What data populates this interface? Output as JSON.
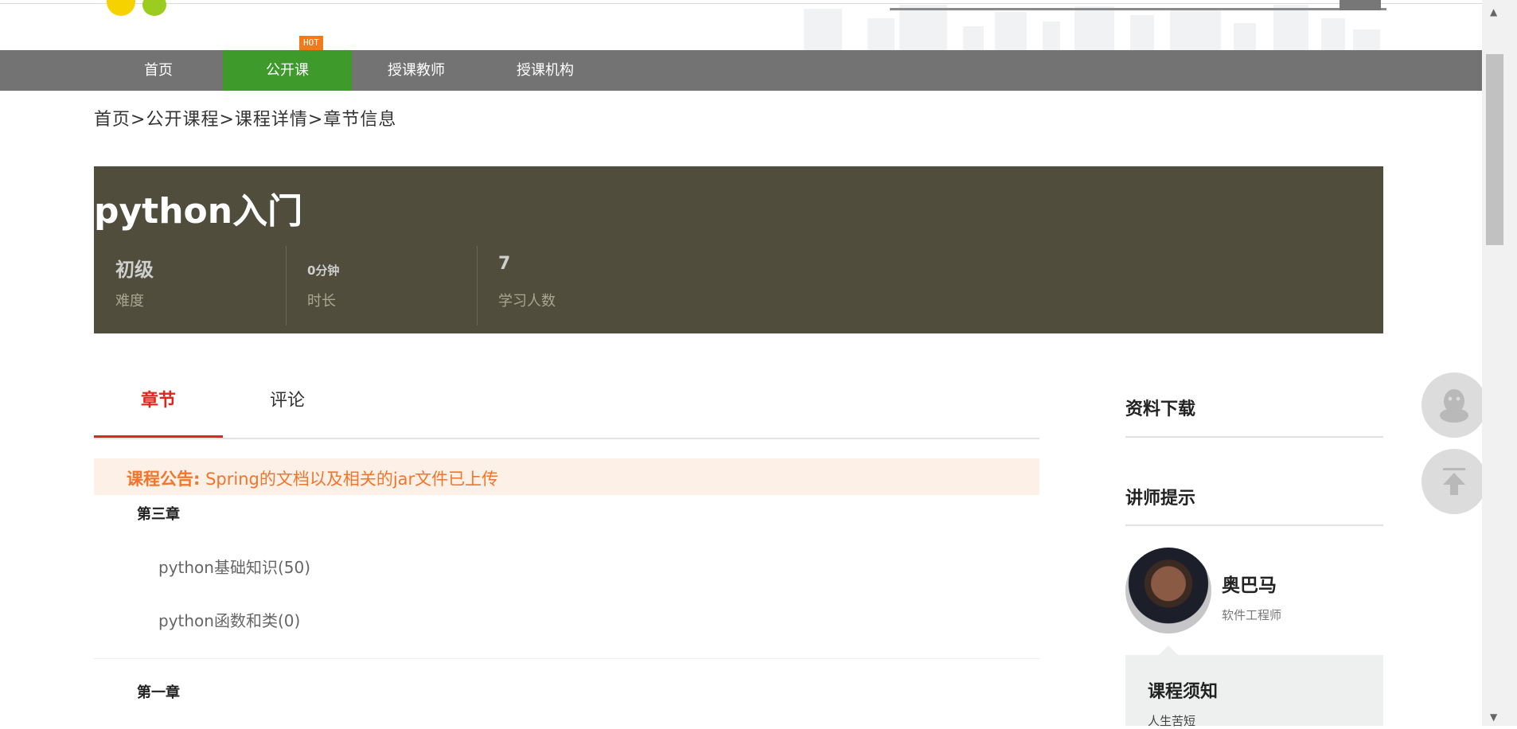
{
  "nav": {
    "items": [
      "首页",
      "公开课",
      "授课教师",
      "授课机构"
    ],
    "active_index": 1,
    "hot_badge": "HOT"
  },
  "breadcrumb": [
    "首页",
    ">",
    "公开课程",
    ">",
    "课程详情",
    ">",
    "章节信息"
  ],
  "course": {
    "title": "python入门",
    "stats": [
      {
        "value": "初级",
        "label": "难度"
      },
      {
        "value": "0分钟",
        "label": "时长"
      },
      {
        "value": "7",
        "label": "学习人数"
      }
    ]
  },
  "tabs": [
    "章节",
    "评论"
  ],
  "notice": {
    "label": "课程公告:",
    "text": " Spring的文档以及相关的jar文件已上传"
  },
  "chapters": [
    {
      "title": "第三章",
      "lessons": [
        "python基础知识(50)",
        "python函数和类(0)"
      ]
    },
    {
      "title": "第一章",
      "lessons": []
    }
  ],
  "sidebar": {
    "download_title": "资料下载",
    "teacher_tip_title": "讲师提示",
    "teacher": {
      "name": "奥巴马",
      "role": "软件工程师"
    },
    "course_notice_title": "课程须知",
    "course_notice_text": "人生苦短"
  },
  "colors": {
    "nav_bg": "#737373",
    "nav_active": "#3f9a2c",
    "banner_bg": "#504d3c",
    "tab_active": "#e0261b",
    "notice_text": "#f3742b"
  },
  "icons": {
    "float_top": "qq-icon",
    "float_bottom": "back-to-top-icon"
  }
}
